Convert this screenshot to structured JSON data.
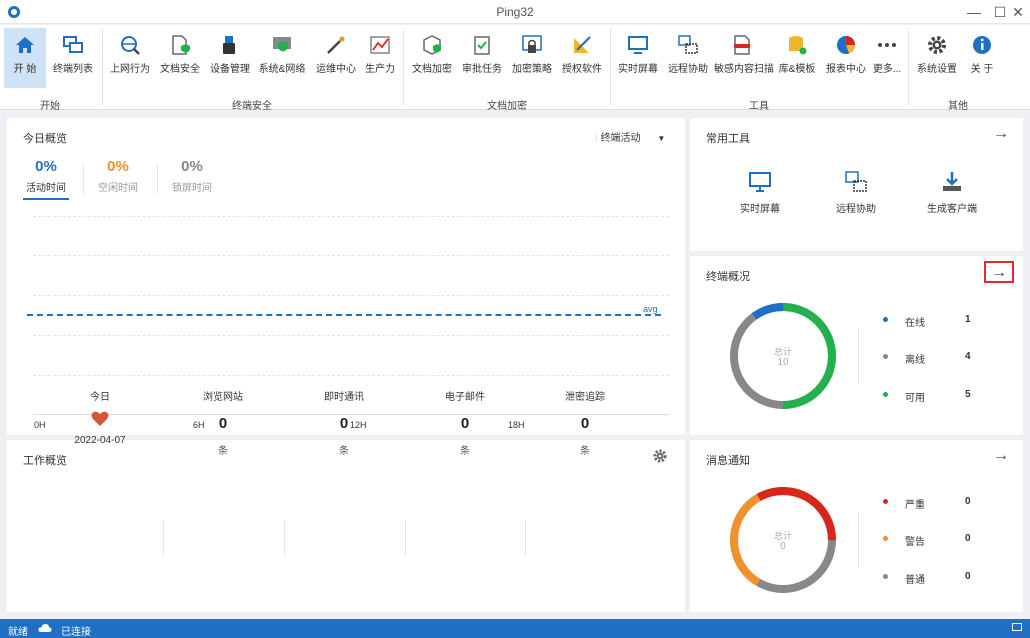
{
  "window": {
    "title": "Ping32"
  },
  "ribbon": {
    "groups": [
      {
        "title": "开始",
        "items": [
          "开 始",
          "终端列表"
        ]
      },
      {
        "title": "终端安全",
        "items": [
          "上网行为",
          "文档安全",
          "设备管理",
          "系统&网络",
          "运维中心",
          "生产力"
        ]
      },
      {
        "title": "文档加密",
        "items": [
          "文档加密",
          "审批任务",
          "加密策略",
          "授权软件"
        ]
      },
      {
        "title": "工具",
        "items": [
          "实时屏幕",
          "远程协助",
          "敏感内容扫描",
          "库&模板",
          "报表中心",
          "更多..."
        ]
      },
      {
        "title": "其他",
        "items": [
          "系统设置",
          "关 于"
        ]
      }
    ]
  },
  "today": {
    "title": "今日概览",
    "filter": "终端活动",
    "stats": [
      {
        "value": "0%",
        "label": "活动时间",
        "color": "#1f6fc5"
      },
      {
        "value": "0%",
        "label": "空闲时间",
        "color": "#f0922b"
      },
      {
        "value": "0%",
        "label": "锁屏时间",
        "color": "#888888"
      }
    ],
    "chart_data": {
      "type": "line",
      "x_ticks": [
        "0H",
        "6H",
        "12H",
        "18H"
      ],
      "series": [],
      "reference_line": {
        "label": "avg",
        "color": "#1f6fc5"
      },
      "grid": true
    }
  },
  "tools": {
    "title": "常用工具",
    "items": [
      "实时屏幕",
      "远程协助",
      "生成客户端"
    ]
  },
  "terminal": {
    "title": "终端概况",
    "center_label": "总计",
    "center_value": "10",
    "legend": [
      {
        "name": "在线",
        "value": "1",
        "color": "#1f6fc5"
      },
      {
        "name": "离线",
        "value": "4",
        "color": "#888888"
      },
      {
        "name": "可用",
        "value": "5",
        "color": "#22b14c"
      }
    ],
    "chart_data": {
      "type": "pie",
      "categories": [
        "在线",
        "可用",
        "离线"
      ],
      "values": [
        1,
        5,
        4
      ]
    }
  },
  "work": {
    "title": "工作概览",
    "today_label": "今日",
    "date": "2022-04-07",
    "columns": [
      {
        "title": "浏览网站",
        "count": "0",
        "unit": "条"
      },
      {
        "title": "即时通讯",
        "count": "0",
        "unit": "条"
      },
      {
        "title": "电子邮件",
        "count": "0",
        "unit": "条"
      },
      {
        "title": "泄密追踪",
        "count": "0",
        "unit": "条"
      }
    ]
  },
  "messages": {
    "title": "消息通知",
    "center_label": "总计",
    "center_value": "0",
    "legend": [
      {
        "name": "严重",
        "value": "0",
        "color": "#d9261c"
      },
      {
        "name": "警告",
        "value": "0",
        "color": "#f0922b"
      },
      {
        "name": "普通",
        "value": "0",
        "color": "#888888"
      }
    ]
  },
  "statusbar": {
    "left": "就绪",
    "connection": "已连接"
  }
}
